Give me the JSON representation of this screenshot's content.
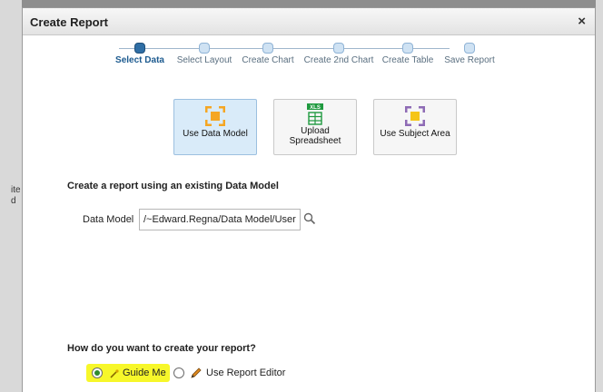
{
  "background": {
    "text_lines": [
      "ite",
      "d"
    ]
  },
  "dialog": {
    "title": "Create Report",
    "close_glyph": "×"
  },
  "train": {
    "steps": [
      {
        "label": "Select Data",
        "current": true
      },
      {
        "label": "Select Layout",
        "current": false
      },
      {
        "label": "Create Chart",
        "current": false
      },
      {
        "label": "Create 2nd Chart",
        "current": false
      },
      {
        "label": "Create Table",
        "current": false
      },
      {
        "label": "Save Report",
        "current": false
      }
    ]
  },
  "sources": {
    "data_model": {
      "label": "Use Data Model",
      "icon": "data-model-icon",
      "selected": true
    },
    "spreadsheet": {
      "label_line1": "Upload",
      "label_line2": "Spreadsheet",
      "badge": "XLS",
      "icon": "spreadsheet-icon"
    },
    "subject_area": {
      "label": "Use Subject Area",
      "icon": "subject-area-icon"
    }
  },
  "section_title": "Create a report using an existing Data Model",
  "data_model": {
    "label": "Data Model",
    "value": "/~Edward.Regna/Data Model/User Rc"
  },
  "question": "How do you want to create your report?",
  "options": {
    "guide_me": {
      "label": "Guide Me",
      "selected": true
    },
    "report_editor": {
      "label": "Use Report Editor",
      "selected": false
    }
  },
  "colors": {
    "accent": "#2f6ea5",
    "highlight": "#f7f72a",
    "orange": "#f5a623",
    "purple": "#8e6bb5",
    "green": "#2e8b2e"
  }
}
